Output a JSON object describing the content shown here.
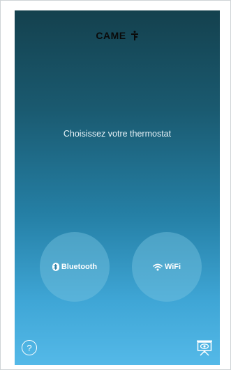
{
  "app": {
    "logo_text": "CAME",
    "logo_mark_icon": "came-figure-icon"
  },
  "main": {
    "prompt": "Choisissez votre thermostat"
  },
  "choices": {
    "bluetooth_label": "Bluetooth",
    "bluetooth_icon": "bluetooth-icon",
    "wifi_label": "WiFi",
    "wifi_icon": "wifi-icon"
  },
  "footer": {
    "help_label": "?",
    "help_icon": "help-icon",
    "demo_icon": "presentation-eye-icon"
  },
  "colors": {
    "gradient_top": "#14414e",
    "gradient_bottom": "#54b9e8",
    "choice_fill": "#78c3e1",
    "text": "#ffffff"
  }
}
